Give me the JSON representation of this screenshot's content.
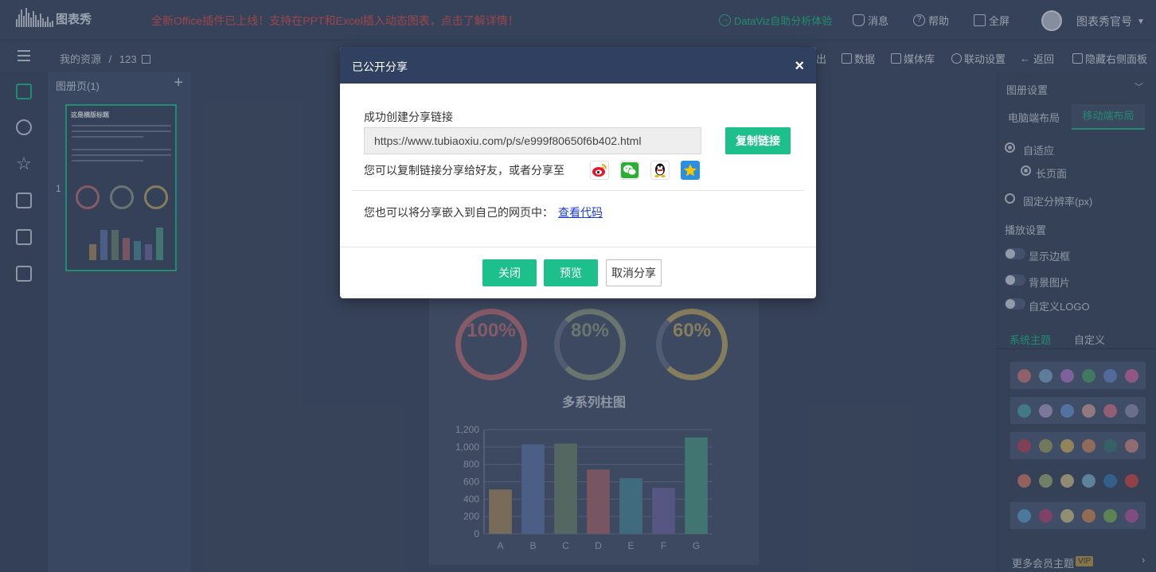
{
  "topbar": {
    "logo_text": "图表秀",
    "marquee": "全新Office插件已上线！支持在PPT和Excel插入动态图表，点击了解详情！",
    "dataviz": "DataViz自助分析体验",
    "messages": "消息",
    "help": "帮助",
    "fullscreen": "全屏",
    "account": "图表秀官号"
  },
  "toolbar": {
    "breadcrumb_root": "我的资源",
    "breadcrumb_sep": "/",
    "breadcrumb_current": "123",
    "export": "出",
    "data": "数据",
    "media": "媒体库",
    "linkage": "联动设置",
    "back": "返回",
    "hide_right": "隐藏右侧面板"
  },
  "pages_panel": {
    "title": "图册页(1)",
    "add": "+",
    "page_number": "1",
    "thumb_title": "这是横版标题"
  },
  "canvas": {
    "rings": [
      {
        "label": "100%",
        "value": 1.0,
        "color": "#b8707a"
      },
      {
        "label": "80%",
        "value": 0.8,
        "color": "#8c9a84"
      },
      {
        "label": "60%",
        "value": 0.6,
        "color": "#b9a66a"
      }
    ],
    "chart_title": "多系列柱图"
  },
  "chart_data": {
    "type": "bar",
    "title": "多系列柱图",
    "categories": [
      "A",
      "B",
      "C",
      "D",
      "E",
      "F",
      "G"
    ],
    "values": [
      510,
      1030,
      1040,
      740,
      640,
      530,
      1110
    ],
    "colors": [
      "#a48a66",
      "#5e77a8",
      "#6e8470",
      "#a26a72",
      "#4e8a9e",
      "#6e6aa2",
      "#4e9a8a"
    ],
    "yticks": [
      "0",
      "200",
      "400",
      "600",
      "800",
      "1,000",
      "1,200"
    ],
    "ylim": [
      0,
      1200
    ],
    "grid": true
  },
  "right_panel": {
    "section_title": "图册设置",
    "tab_pc": "电脑端布局",
    "tab_mobile": "移动端布局",
    "adaptive": "自适应",
    "long_page": "长页面",
    "fixed_res": "固定分辨率(px)",
    "playback": "播放设置",
    "show_border": "显示边框",
    "bg_image": "背景图片",
    "custom_logo": "自定义LOGO",
    "theme_system": "系统主题",
    "theme_custom": "自定义",
    "more_themes": "更多会员主题",
    "vip": "VIP",
    "palettes": [
      [
        "#c97b7b",
        "#7aa6c9",
        "#a97bc9",
        "#4fa06f",
        "#6a86c9",
        "#c96aa9"
      ],
      [
        "#4fa0a8",
        "#a99bc9",
        "#6a96d0",
        "#c9a0a0",
        "#c97790",
        "#8c8fb0"
      ],
      [
        "#b04a60",
        "#99a066",
        "#c9b066",
        "#c98a66",
        "#3c7a7a",
        "#c98a8a"
      ],
      [
        "#c97b6a",
        "#9aaa7a",
        "#c9b98a",
        "#7ab0c9",
        "#3b78b0",
        "#c94a4a"
      ],
      [
        "#5fa0c9",
        "#b04a78",
        "#c9c08a",
        "#c98a5a",
        "#7ab05a",
        "#b05aa0"
      ]
    ]
  },
  "modal": {
    "title": "已公开分享",
    "close_icon": "×",
    "success_label": "成功创建分享链接",
    "url": "https://www.tubiaoxiu.com/p/s/e999f80650f6b402.html",
    "copy_button": "复制链接",
    "share_text": "您可以复制链接分享给好友，或者分享至",
    "embed_text": "您也可以将分享嵌入到自己的网页中：",
    "view_code": "查看代码",
    "close_button": "关闭",
    "preview_button": "预览",
    "cancel_share_button": "取消分享",
    "social_icons": [
      "weibo-icon",
      "wechat-icon",
      "qq-icon",
      "qzone-icon"
    ]
  }
}
